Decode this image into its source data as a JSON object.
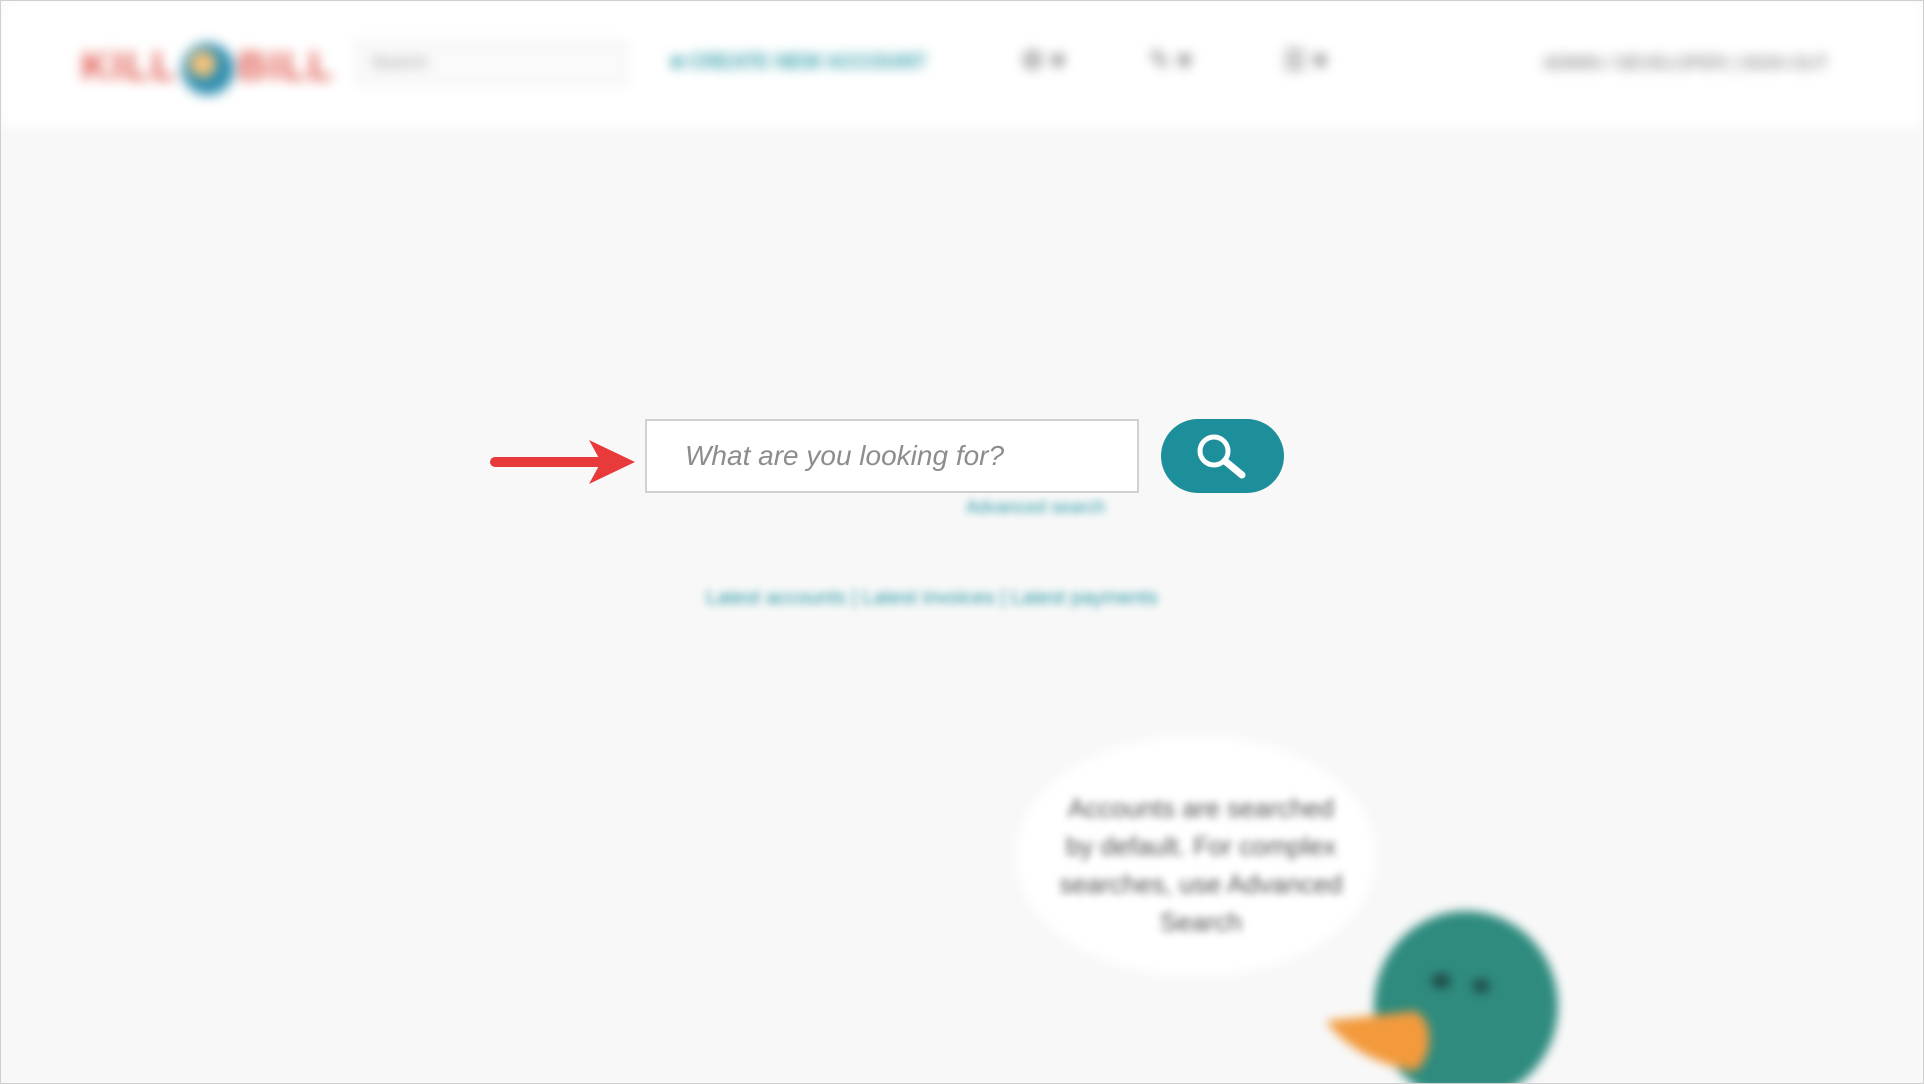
{
  "header": {
    "logo_text_left": "KILL",
    "logo_text_right": "BILL",
    "search_placeholder": "Search",
    "create_account_label": "CREATE NEW ACCOUNT",
    "user_label": "ADMIN / DEVELOPER",
    "signout_label": "SIGN OUT"
  },
  "main": {
    "search_placeholder": "What are you looking for?",
    "advanced_search_label": "Advanced search",
    "quick_links": "Latest accounts | Latest invoices | Latest payments",
    "tip_text": "Accounts are searched by default. For complex searches, use Advanced Search"
  },
  "colors": {
    "accent": "#1c8f9a",
    "arrow": "#e83a3a",
    "logo": "#e05a4f"
  }
}
